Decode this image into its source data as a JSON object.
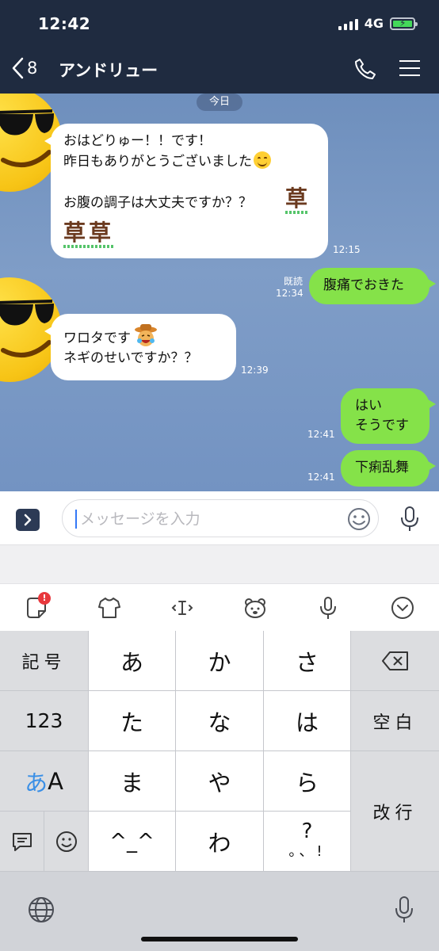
{
  "status_bar": {
    "time": "12:42",
    "network": "4G"
  },
  "nav": {
    "back_count": "8",
    "title": "アンドリュー"
  },
  "chat": {
    "date_label": "今日",
    "messages": [
      {
        "side": "in",
        "lines": [
          "おはどりゅー！！です！",
          "昨日もありがとうございました",
          "",
          "お腹の調子は大丈夫ですか？？"
        ],
        "kusa": [
          "草",
          "草草"
        ],
        "time": "12:15"
      },
      {
        "side": "out",
        "text": "腹痛でおきた",
        "read": "既読",
        "time": "12:34"
      },
      {
        "side": "in",
        "lines": [
          "ワロタです",
          "ネギのせいですか？？"
        ],
        "time": "12:39"
      },
      {
        "side": "out",
        "lines": [
          "はい",
          "そうです"
        ],
        "time": "12:41"
      },
      {
        "side": "out",
        "text": "下痢乱舞",
        "time": "12:41"
      }
    ]
  },
  "input": {
    "placeholder": "メッセージを入力",
    "value": ""
  },
  "keyboard": {
    "left": {
      "symbols": "記号",
      "numbers": "123",
      "kana_a": "あ",
      "kana_A": "A"
    },
    "rows": [
      [
        "あ",
        "か",
        "さ"
      ],
      [
        "た",
        "な",
        "は"
      ],
      [
        "ま",
        "や",
        "ら"
      ],
      [
        "^_^",
        "わ",
        "?"
      ]
    ],
    "punct_row": "。、!",
    "right": {
      "space": "空白",
      "enter": "改行"
    }
  },
  "colors": {
    "header": "#1f2b40",
    "outgoing": "#85e249",
    "incoming": "#ffffff",
    "badge": "#e8383d"
  },
  "icons": [
    "back-icon",
    "phone-icon",
    "menu-icon",
    "expand-icon",
    "emoji-icon",
    "mic-icon",
    "sticker-icon",
    "shirt-icon",
    "cursor-icon",
    "bear-icon",
    "chevron-down-icon",
    "backspace-icon",
    "message-icon",
    "smile-icon",
    "globe-icon"
  ]
}
